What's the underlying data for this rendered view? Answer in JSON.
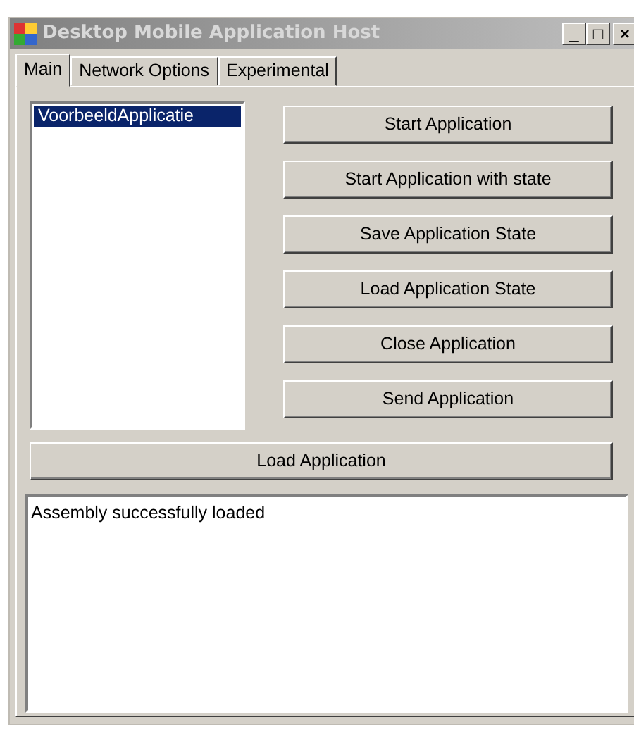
{
  "window": {
    "title": "Desktop Mobile Application Host",
    "controls": [
      "_",
      "□",
      "×"
    ]
  },
  "tabs": [
    {
      "label": "Main",
      "selected": true
    },
    {
      "label": "Network Options",
      "selected": false
    },
    {
      "label": "Experimental",
      "selected": false
    }
  ],
  "applications": [
    {
      "label": "VoorbeeldApplicatie",
      "selected": true
    }
  ],
  "buttons": [
    "Start Application",
    "Start Application with state",
    "Save Application State",
    "Load Application State",
    "Close Application",
    "Send Application"
  ],
  "load_button": "Load Application",
  "log": "Assembly successfully loaded"
}
